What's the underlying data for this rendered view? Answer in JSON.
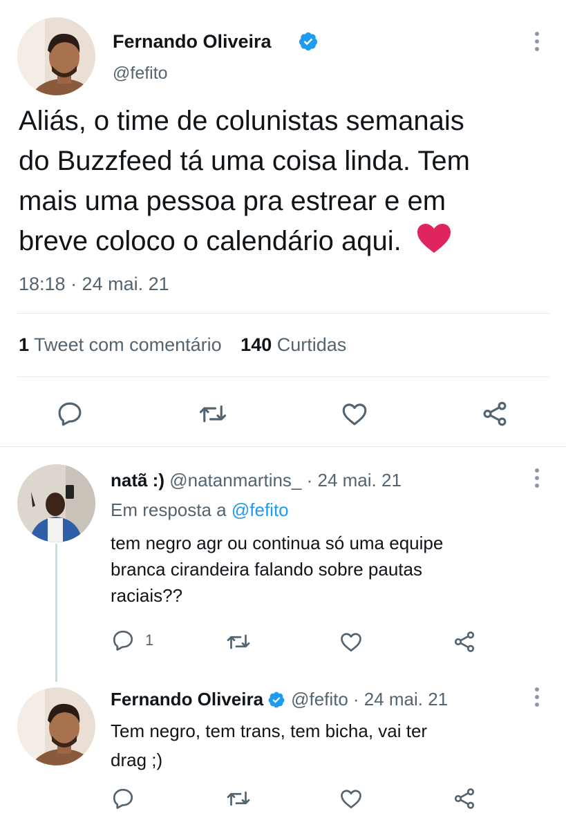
{
  "colors": {
    "text": "#0f1419",
    "secondary": "#536471",
    "accent": "#1d9bf0",
    "heart": "#e0245e",
    "divider": "#e6e9ec"
  },
  "main_tweet": {
    "author_name": "Fernando Oliveira",
    "author_handle": "@fefito",
    "verified": true,
    "text_lines": [
      "Aliás, o time de colunistas semanais",
      "do Buzzfeed tá uma coisa linda. Tem",
      "mais uma pessoa pra estrear e em",
      "breve coloco o calendário aqui."
    ],
    "emoji": "red-heart",
    "timestamp": "18:18 · 24 mai. 21",
    "stats": {
      "quotes_count": "1",
      "quotes_label": "Tweet com comentário",
      "likes_count": "140",
      "likes_label": "Curtidas"
    },
    "actions": [
      "reply-icon",
      "retweet-icon",
      "like-icon",
      "share-icon"
    ]
  },
  "reply_1": {
    "author_name": "natã :)",
    "author_handle": "@natanmartins_",
    "date": "· 24 mai. 21",
    "reply_to_prefix": "Em resposta a",
    "reply_to_handle": "@fefito",
    "text_lines": [
      "tem negro agr ou continua só uma equipe",
      "branca cirandeira falando sobre pautas",
      "raciais??"
    ],
    "reply_count": "1"
  },
  "reply_2": {
    "author_name": "Fernando Oliveira",
    "author_handle": "@fefito",
    "date": "· 24 mai. 21",
    "verified": true,
    "text_lines": [
      "Tem negro, tem trans, tem bicha, vai ter",
      "drag ;)"
    ]
  }
}
